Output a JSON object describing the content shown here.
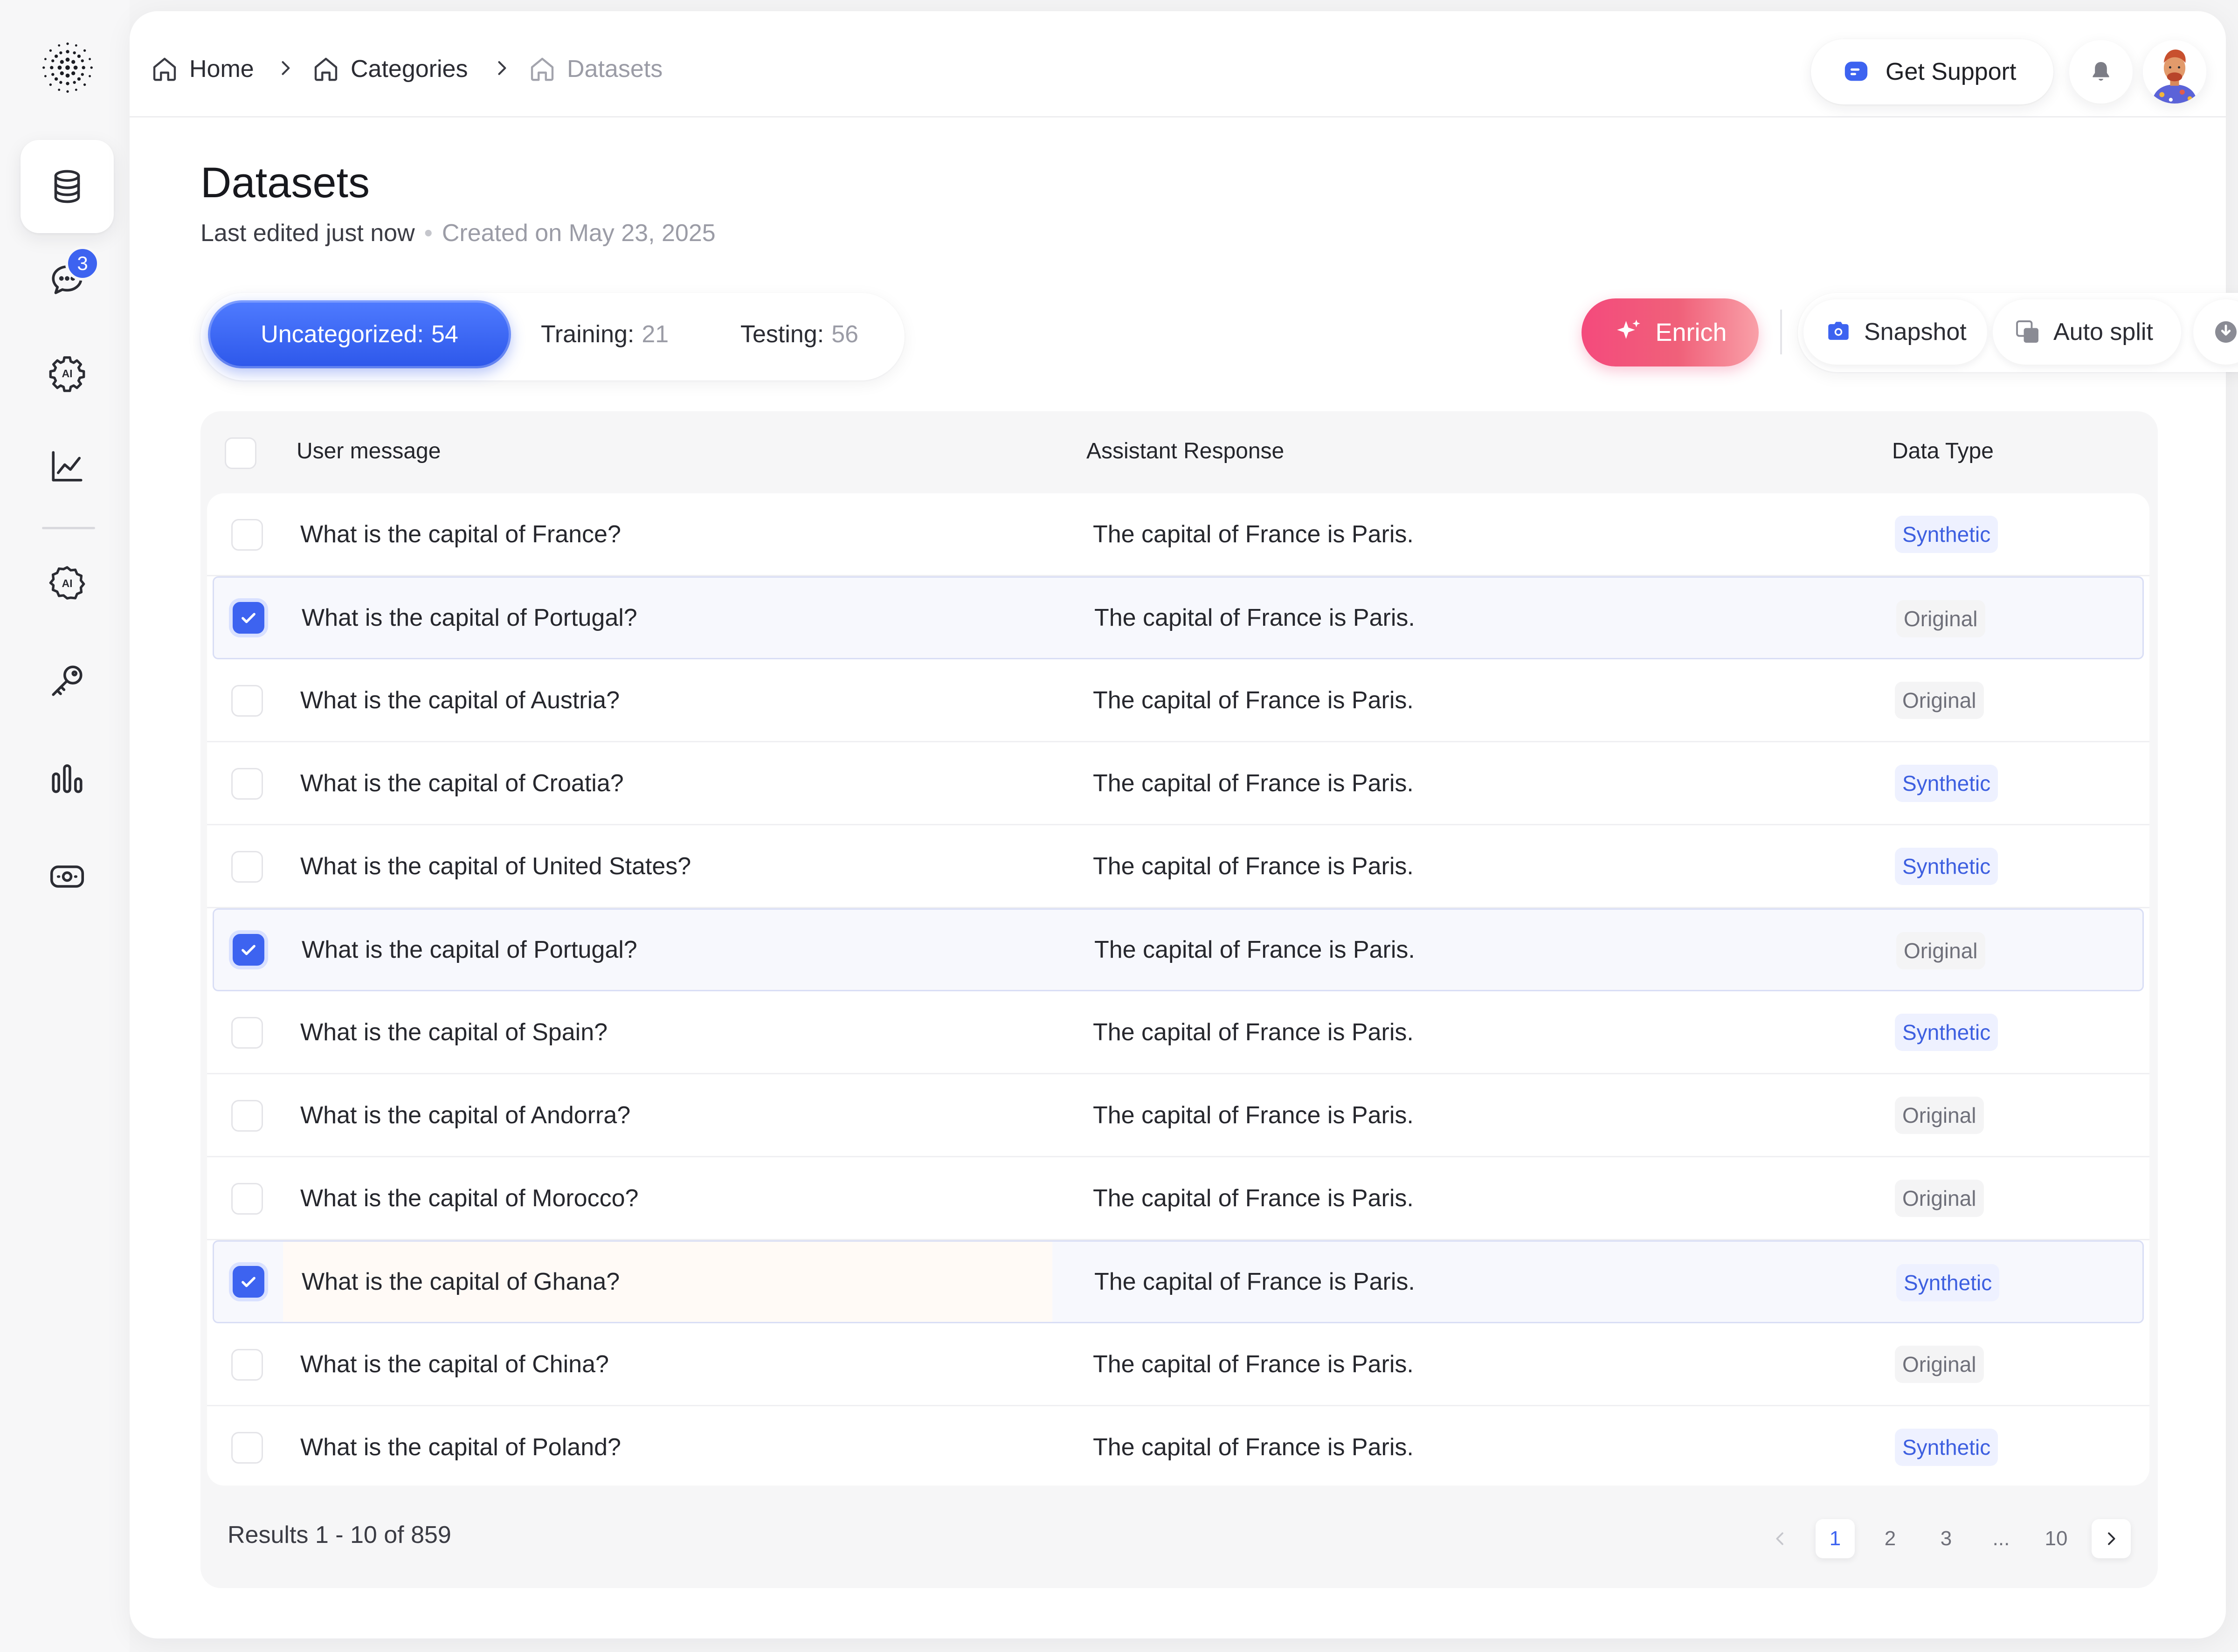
{
  "breadcrumb": {
    "home": "Home",
    "categories": "Categories",
    "current": "Datasets"
  },
  "header": {
    "support_label": "Get Support"
  },
  "sidebar": {
    "badge_count": "3"
  },
  "page": {
    "title": "Datasets",
    "last_edited": "Last edited just now",
    "created": "Created on May 23, 2025"
  },
  "tabs": [
    {
      "label": "Uncategorized:",
      "count": "54"
    },
    {
      "label": "Training:",
      "count": "21"
    },
    {
      "label": "Testing:",
      "count": "56"
    }
  ],
  "actions": {
    "enrich": "Enrich",
    "snapshot": "Snapshot",
    "auto_split": "Auto split"
  },
  "table": {
    "columns": [
      "User message",
      "Assistant Response",
      "Data Type"
    ],
    "rows": [
      {
        "checked": false,
        "user": "What is the capital of France?",
        "assistant": "The capital of France is Paris.",
        "type": "Synthetic"
      },
      {
        "checked": true,
        "user": "What is the capital of Portugal?",
        "assistant": "The capital of France is Paris.",
        "type": "Original"
      },
      {
        "checked": false,
        "user": "What is the capital of Austria?",
        "assistant": "The capital of France is Paris.",
        "type": "Original"
      },
      {
        "checked": false,
        "user": "What is the capital of Croatia?",
        "assistant": "The capital of France is Paris.",
        "type": "Synthetic"
      },
      {
        "checked": false,
        "user": "What is the capital of United States?",
        "assistant": "The capital of France is Paris.",
        "type": "Synthetic"
      },
      {
        "checked": true,
        "user": "What is the capital of Portugal?",
        "assistant": "The capital of France is Paris.",
        "type": "Original"
      },
      {
        "checked": false,
        "user": "What is the capital of Spain?",
        "assistant": "The capital of France is Paris.",
        "type": "Synthetic"
      },
      {
        "checked": false,
        "user": "What is the capital of Andorra?",
        "assistant": "The capital of France is Paris.",
        "type": "Original"
      },
      {
        "checked": false,
        "user": "What is the capital of Morocco?",
        "assistant": "The capital of France is Paris.",
        "type": "Original"
      },
      {
        "checked": true,
        "user": "What is the capital of Ghana?",
        "assistant": "The capital of France is Paris.",
        "type": "Synthetic"
      },
      {
        "checked": false,
        "user": "What is the capital of China?",
        "assistant": "The capital of France is Paris.",
        "type": "Original"
      },
      {
        "checked": false,
        "user": "What is the capital of Poland?",
        "assistant": "The capital of France is Paris.",
        "type": "Synthetic"
      }
    ]
  },
  "pagination": {
    "results": "Results 1 - 10 of 859",
    "pages": [
      "1",
      "2",
      "3",
      "...",
      "10"
    ],
    "current": "1"
  },
  "colors": {
    "accent": "#3d63f0",
    "enrich_start": "#f44a7c",
    "enrich_end": "#f9a0a8",
    "synthetic": "#3d5fe0"
  }
}
